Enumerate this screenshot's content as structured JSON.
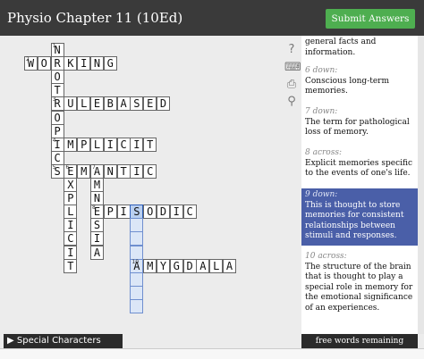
{
  "header": {
    "title": "Physio Chapter 11 (10Ed)",
    "submit_label": "Submit Answers"
  },
  "toolbar": {
    "help_icon": "?",
    "keyboard_icon": "⌨",
    "print_icon": "⎙",
    "zoom_icon": "⚲"
  },
  "grid": {
    "cells": [
      {
        "r": 0,
        "c": 2,
        "ch": "N",
        "n": "1"
      },
      {
        "r": 1,
        "c": 0,
        "ch": "W",
        "n": "2"
      },
      {
        "r": 1,
        "c": 1,
        "ch": "O"
      },
      {
        "r": 1,
        "c": 2,
        "ch": "R"
      },
      {
        "r": 1,
        "c": 3,
        "ch": "K"
      },
      {
        "r": 1,
        "c": 4,
        "ch": "I"
      },
      {
        "r": 1,
        "c": 5,
        "ch": "N"
      },
      {
        "r": 1,
        "c": 6,
        "ch": "G"
      },
      {
        "r": 2,
        "c": 2,
        "ch": "O"
      },
      {
        "r": 3,
        "c": 2,
        "ch": "T"
      },
      {
        "r": 4,
        "c": 2,
        "ch": "R",
        "n": "3"
      },
      {
        "r": 4,
        "c": 3,
        "ch": "U"
      },
      {
        "r": 4,
        "c": 4,
        "ch": "L"
      },
      {
        "r": 4,
        "c": 5,
        "ch": "E"
      },
      {
        "r": 4,
        "c": 6,
        "ch": "B"
      },
      {
        "r": 4,
        "c": 7,
        "ch": "A"
      },
      {
        "r": 4,
        "c": 8,
        "ch": "S"
      },
      {
        "r": 4,
        "c": 9,
        "ch": "E"
      },
      {
        "r": 4,
        "c": 10,
        "ch": "D"
      },
      {
        "r": 5,
        "c": 2,
        "ch": "O"
      },
      {
        "r": 6,
        "c": 2,
        "ch": "P"
      },
      {
        "r": 7,
        "c": 2,
        "ch": "I",
        "n": "4"
      },
      {
        "r": 7,
        "c": 3,
        "ch": "M"
      },
      {
        "r": 7,
        "c": 4,
        "ch": "P"
      },
      {
        "r": 7,
        "c": 5,
        "ch": "L"
      },
      {
        "r": 7,
        "c": 6,
        "ch": "I"
      },
      {
        "r": 7,
        "c": 7,
        "ch": "C"
      },
      {
        "r": 7,
        "c": 8,
        "ch": "I"
      },
      {
        "r": 7,
        "c": 9,
        "ch": "T"
      },
      {
        "r": 8,
        "c": 2,
        "ch": "C"
      },
      {
        "r": 9,
        "c": 2,
        "ch": "S",
        "n": "5"
      },
      {
        "r": 9,
        "c": 3,
        "ch": "E",
        "n": "6"
      },
      {
        "r": 9,
        "c": 4,
        "ch": "M"
      },
      {
        "r": 9,
        "c": 5,
        "ch": "A",
        "n": "7"
      },
      {
        "r": 9,
        "c": 6,
        "ch": "N"
      },
      {
        "r": 9,
        "c": 7,
        "ch": "T"
      },
      {
        "r": 9,
        "c": 8,
        "ch": "I"
      },
      {
        "r": 9,
        "c": 9,
        "ch": "C"
      },
      {
        "r": 10,
        "c": 3,
        "ch": "X"
      },
      {
        "r": 10,
        "c": 5,
        "ch": "M"
      },
      {
        "r": 11,
        "c": 3,
        "ch": "P"
      },
      {
        "r": 11,
        "c": 5,
        "ch": "N"
      },
      {
        "r": 12,
        "c": 3,
        "ch": "L"
      },
      {
        "r": 12,
        "c": 5,
        "ch": "E",
        "n": "8"
      },
      {
        "r": 12,
        "c": 6,
        "ch": "P"
      },
      {
        "r": 12,
        "c": 7,
        "ch": "I"
      },
      {
        "r": 12,
        "c": 8,
        "ch": "S",
        "act": true
      },
      {
        "r": 12,
        "c": 9,
        "ch": "O"
      },
      {
        "r": 12,
        "c": 10,
        "ch": "D"
      },
      {
        "r": 12,
        "c": 11,
        "ch": "I"
      },
      {
        "r": 12,
        "c": 12,
        "ch": "C"
      },
      {
        "r": 13,
        "c": 3,
        "ch": "I"
      },
      {
        "r": 13,
        "c": 5,
        "ch": "S"
      },
      {
        "r": 13,
        "c": 8,
        "ch": "",
        "hl": true
      },
      {
        "r": 14,
        "c": 3,
        "ch": "C"
      },
      {
        "r": 14,
        "c": 5,
        "ch": "I"
      },
      {
        "r": 14,
        "c": 8,
        "ch": "",
        "hl": true
      },
      {
        "r": 15,
        "c": 3,
        "ch": "I"
      },
      {
        "r": 15,
        "c": 5,
        "ch": "A"
      },
      {
        "r": 15,
        "c": 8,
        "ch": "",
        "hl": true
      },
      {
        "r": 16,
        "c": 3,
        "ch": "T"
      },
      {
        "r": 16,
        "c": 8,
        "ch": "A",
        "n": "10",
        "hl": true
      },
      {
        "r": 16,
        "c": 9,
        "ch": "M"
      },
      {
        "r": 16,
        "c": 10,
        "ch": "Y"
      },
      {
        "r": 16,
        "c": 11,
        "ch": "G"
      },
      {
        "r": 16,
        "c": 12,
        "ch": "D"
      },
      {
        "r": 16,
        "c": 13,
        "ch": "A"
      },
      {
        "r": 16,
        "c": 14,
        "ch": "L"
      },
      {
        "r": 16,
        "c": 15,
        "ch": "A"
      },
      {
        "r": 17,
        "c": 8,
        "ch": "",
        "hl": true
      },
      {
        "r": 18,
        "c": 8,
        "ch": "",
        "hl": true
      },
      {
        "r": 19,
        "c": 8,
        "ch": "",
        "hl": true
      }
    ]
  },
  "clues": [
    {
      "label": "",
      "text": "general facts and information.",
      "active": false
    },
    {
      "label": "6 down:",
      "text": "Conscious long-term memories.",
      "active": false
    },
    {
      "label": "7 down:",
      "text": "The term for pathological loss of memory.",
      "active": false
    },
    {
      "label": "8 across:",
      "text": "Explicit memories specific to the events of one's life.",
      "active": false
    },
    {
      "label": "9 down:",
      "text": "This is thought to store memories for consistent relationships between stimuli and responses.",
      "active": true
    },
    {
      "label": "10 across:",
      "text": "The structure of the brain that is thought to play a special role in memory for the emotional significance of an experiences.",
      "active": false
    }
  ],
  "footer": {
    "special_chars_label": "▶ Special Characters",
    "free_words_label": "free words remaining"
  }
}
